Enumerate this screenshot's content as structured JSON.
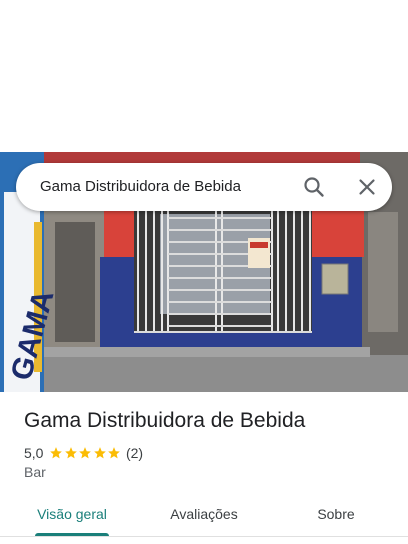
{
  "search": {
    "query": "Gama Distribuidora de Bebida"
  },
  "place": {
    "name": "Gama Distribuidora de Bebida",
    "rating": "5,0",
    "stars": 5,
    "review_count": "(2)",
    "category": "Bar",
    "banner_text": "GAMA"
  },
  "tabs": [
    {
      "label": "Visão geral",
      "active": true
    },
    {
      "label": "Avaliações",
      "active": false
    },
    {
      "label": "Sobre",
      "active": false
    }
  ],
  "colors": {
    "accent": "#1a7f7a",
    "star": "#fbbc04",
    "wall_blue": "#2c3f8f",
    "wall_red": "#d8433a"
  },
  "icons": [
    "search-icon",
    "close-icon",
    "star-icon"
  ]
}
